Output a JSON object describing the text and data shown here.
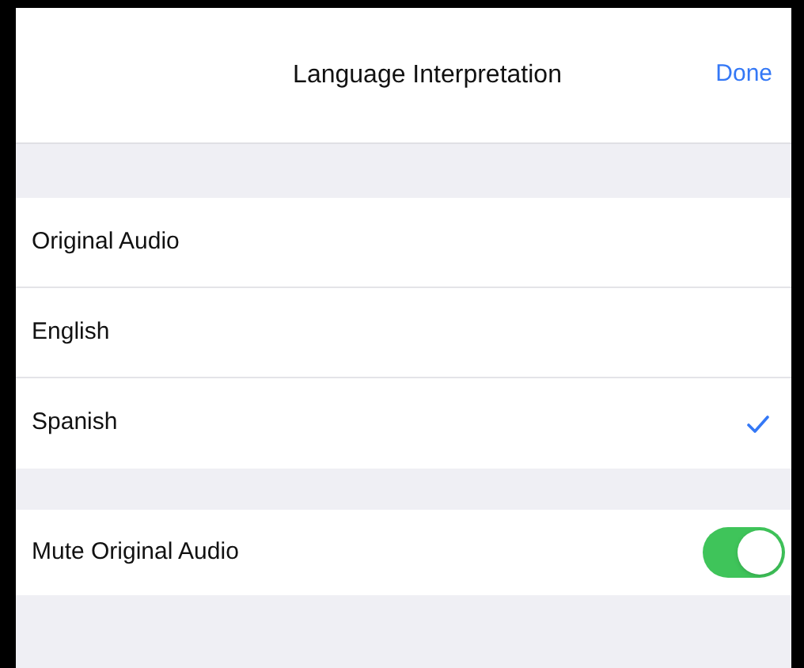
{
  "header": {
    "title": "Language Interpretation",
    "done": "Done"
  },
  "languages": [
    {
      "label": "Original Audio",
      "selected": false
    },
    {
      "label": "English",
      "selected": false
    },
    {
      "label": "Spanish",
      "selected": true
    }
  ],
  "mute": {
    "label": "Mute Original Audio",
    "on": true
  }
}
